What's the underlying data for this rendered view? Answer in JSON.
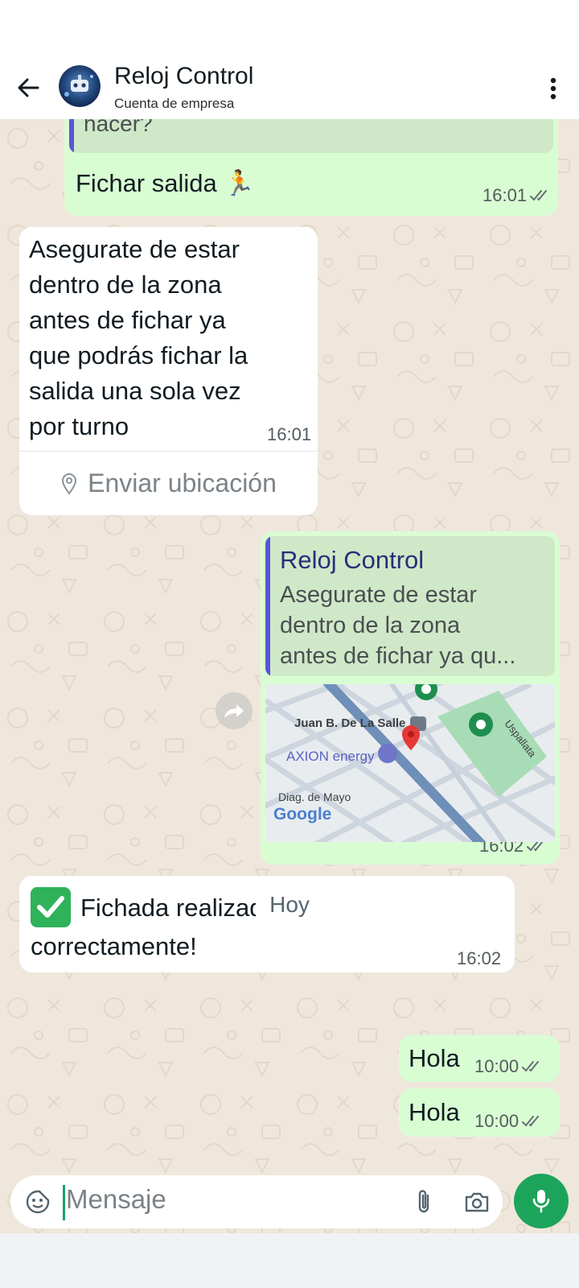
{
  "header": {
    "title": "Reloj Control",
    "subtitle": "Cuenta de empresa"
  },
  "messages": {
    "m1": {
      "quote_partial": "hacer?",
      "text": "Fichar salida 🏃",
      "time": "16:01"
    },
    "m2": {
      "text_lines": [
        "Asegurate de estar",
        "dentro de la zona",
        "antes de fichar ya",
        "que podrás fichar la",
        "salida una sola vez",
        "por turno"
      ],
      "time": "16:01",
      "button_label": "Enviar ubicación"
    },
    "m3": {
      "quote_author": "Reloj Control",
      "quote_lines": [
        "Asegurate de estar",
        "dentro de la zona",
        "antes de fichar ya qu..."
      ],
      "map_labels": {
        "station": "Juan B. De La Salle",
        "fuel": "AXION energy",
        "street1": "Diag. de Mayo",
        "street2": "Uspallata",
        "logo": "Google"
      },
      "time": "16:02"
    },
    "m4": {
      "line1": "Fichada realizada",
      "line2": "correctamente!",
      "time": "16:02"
    },
    "date_chip": "Hoy",
    "m5": {
      "text": "Hola",
      "time": "10:00"
    },
    "m6": {
      "text": "Hola",
      "time": "10:00"
    }
  },
  "composer": {
    "placeholder": "Mensaje"
  },
  "colors": {
    "outgoing_bubble": "#d9fdd3",
    "incoming_bubble": "#ffffff",
    "accent_green": "#1da45b",
    "quote_bar": "#5a55d6",
    "wallpaper": "#efe7dc"
  }
}
